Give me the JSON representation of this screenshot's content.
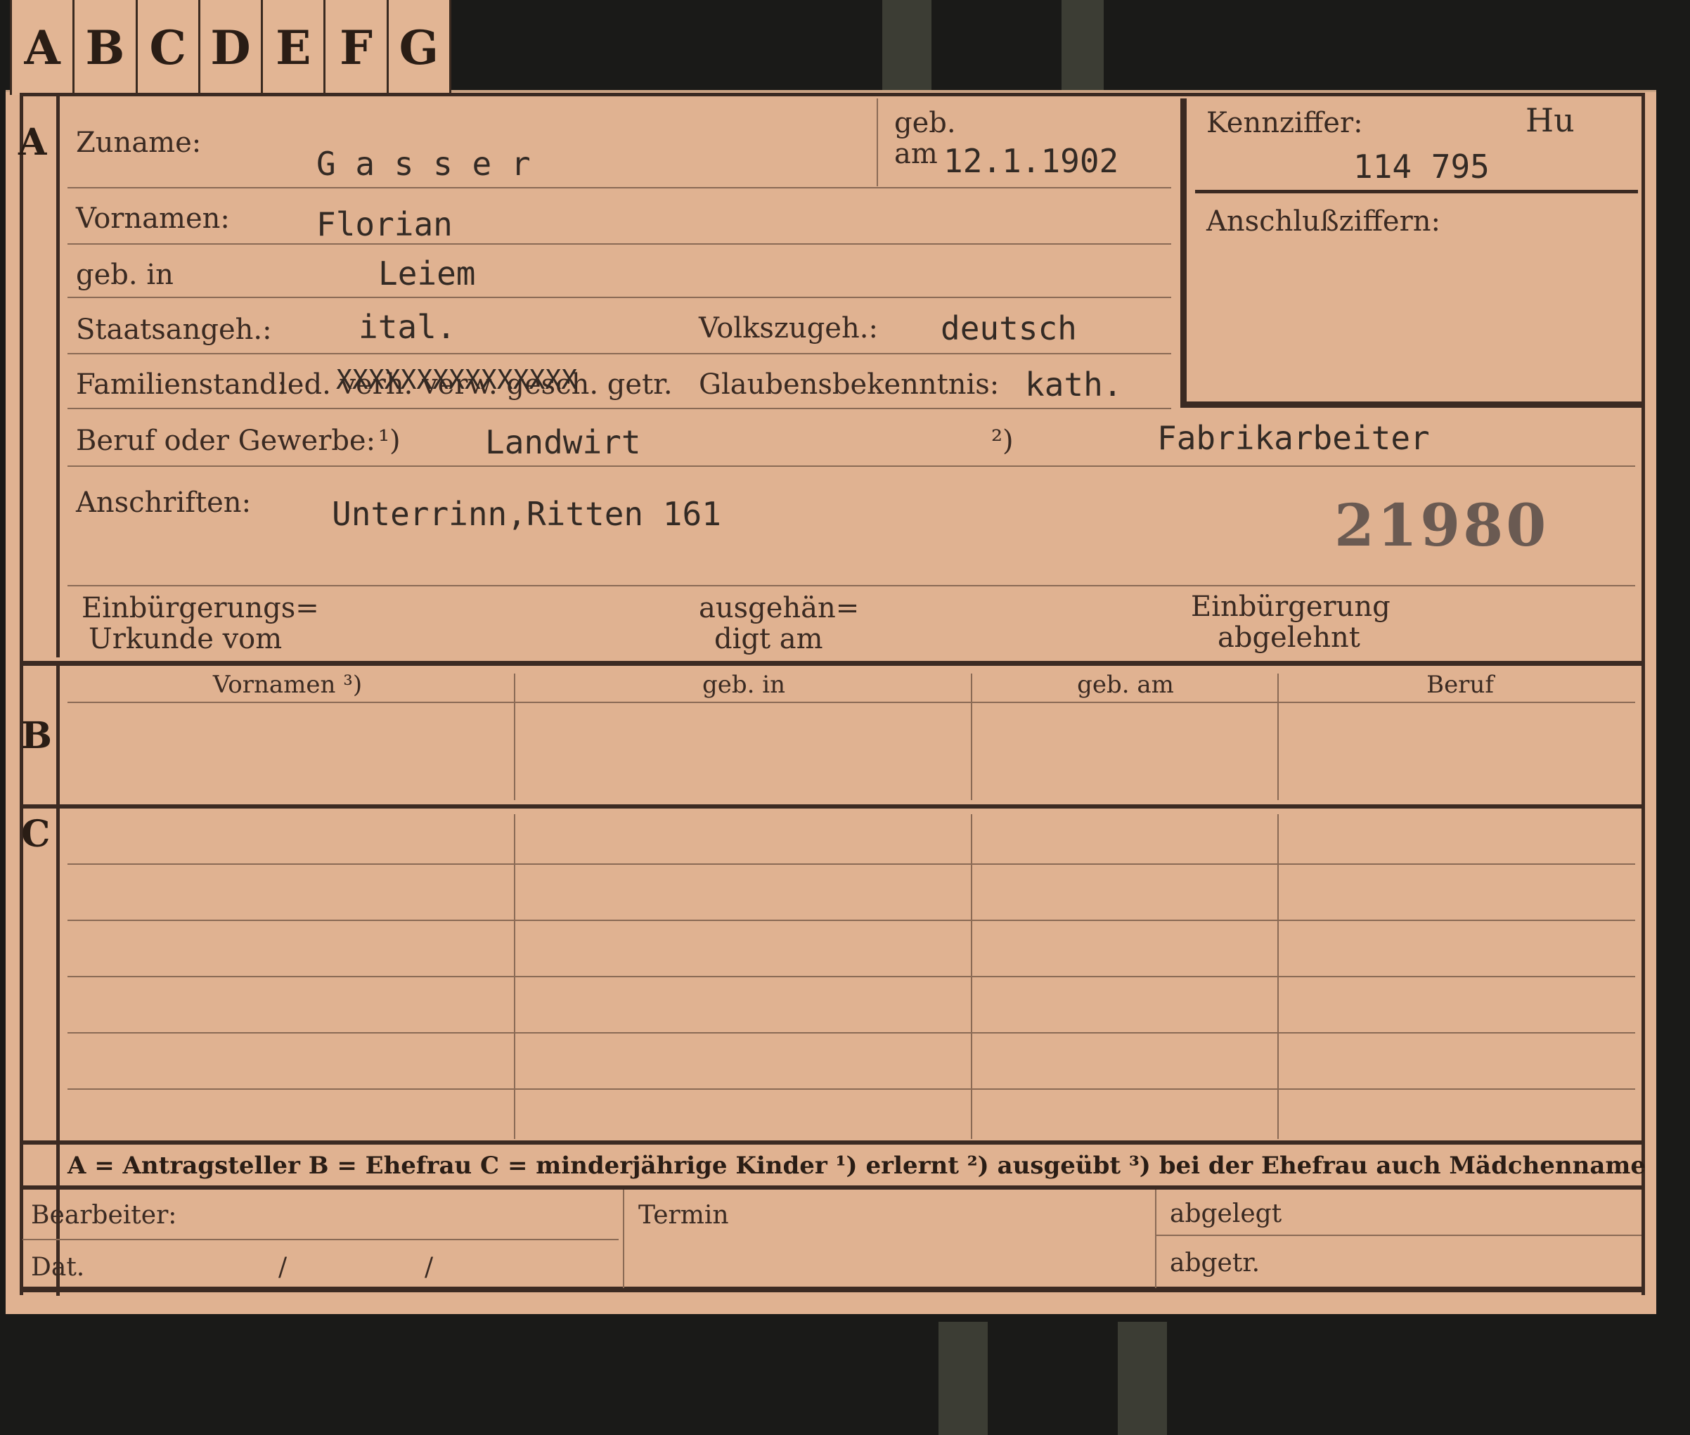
{
  "tabs": [
    "A",
    "B",
    "C",
    "D",
    "E",
    "F",
    "G"
  ],
  "sections": {
    "a": "A",
    "b": "B",
    "c": "C"
  },
  "labels": {
    "zuname": "Zuname:",
    "geb": "geb.",
    "am": "am",
    "kennziffer": "Kennziffer:",
    "anschlussziffern": "Anschlußziffern:",
    "vornamen": "Vornamen:",
    "geb_in": "geb. in",
    "staatsangeh": "Staatsangeh.:",
    "volkszugeh": "Volkszugeh.:",
    "familienstand": "Familienstand:",
    "familienstand_opts": "led. verh. verw. gesch. getr.",
    "glaubensbekenntnis": "Glaubensbekenntnis:",
    "beruf": "Beruf oder Gewerbe:",
    "note1": "¹)",
    "note2": "²)",
    "anschriften": "Anschriften:",
    "einbuergerungs_1": "Einbürgerungs=",
    "einbuergerungs_2": "Urkunde vom",
    "ausgehaen_1": "ausgehän=",
    "ausgehaen_2": "digt am",
    "abgelehnt_1": "Einbürgerung",
    "abgelehnt_2": "abgelehnt"
  },
  "values": {
    "zuname": "G a s s e r",
    "geb_am": "12.1.1902",
    "kennziffer_prefix": "Hu",
    "kennziffer": "114 795",
    "vornamen": "Florian",
    "geb_in": "Leiem",
    "staatsangeh": "ital.",
    "volkszugeh": "deutsch",
    "familienstand_strike": "XXXXXXXXXXXXXXX",
    "glaubensbekenntnis": "kath.",
    "beruf_1": "Landwirt",
    "beruf_2": "Fabrikarbeiter",
    "anschrift": "Unterrinn,Ritten 161",
    "stamp_number": "21980"
  },
  "table": {
    "headers": [
      "Vornamen ³)",
      "geb. in",
      "geb. am",
      "Beruf"
    ]
  },
  "legend": "A = Antragsteller   B = Ehefrau   C = minderjährige Kinder   ¹) erlernt   ²) ausgeübt   ³) bei der Ehefrau auch Mädchenname",
  "footer": {
    "bearbeiter": "Bearbeiter:",
    "dat": "Dat.",
    "slash1": "/",
    "slash2": "/",
    "termin": "Termin",
    "abgelegt": "abgelegt",
    "abgetr": "abgetr."
  }
}
